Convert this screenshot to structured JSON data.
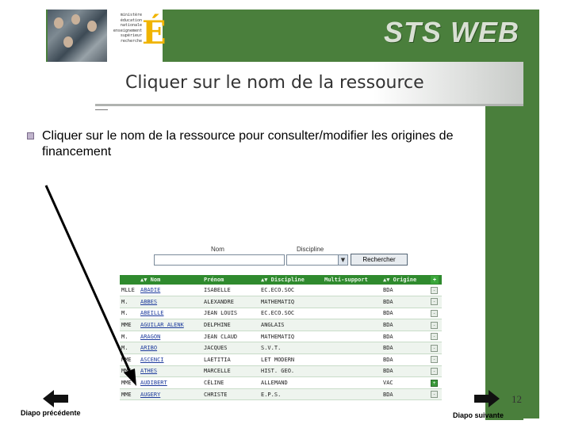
{
  "header": {
    "app_title": "STS WEB",
    "logo_lines": [
      "ministère",
      "éducation",
      "nationale",
      "enseignement",
      "supérieur",
      "recherche"
    ],
    "logo_mark": "É"
  },
  "slide": {
    "title": "Cliquer sur le nom de la ressource",
    "bullet": "Cliquer sur le nom de la ressource pour consulter/modifier les origines de financement",
    "page_number": "12"
  },
  "search_form": {
    "nom_label": "Nom",
    "discipline_label": "Discipline",
    "nom_value": "",
    "discipline_value": "",
    "search_button": "Rechercher"
  },
  "table": {
    "columns": [
      "",
      "Nom",
      "Prénom",
      "Discipline",
      "Multi-support",
      "Origine",
      ""
    ],
    "rows": [
      {
        "civ": "MLLE",
        "nom": "ABADIE",
        "prenom": "ISABELLE",
        "discipline": "EC.ECO.SOC",
        "multi": "",
        "origine": "BDA",
        "active": false
      },
      {
        "civ": "M.",
        "nom": "ABBES",
        "prenom": "ALEXANDRE",
        "discipline": "MATHEMATIQ",
        "multi": "",
        "origine": "BDA",
        "active": false
      },
      {
        "civ": "M.",
        "nom": "ABEILLE",
        "prenom": "JEAN LOUIS",
        "discipline": "EC.ECO.SOC",
        "multi": "",
        "origine": "BDA",
        "active": false
      },
      {
        "civ": "MME",
        "nom": "AGUILAR ALENK",
        "prenom": "DELPHINE",
        "discipline": "ANGLAIS",
        "multi": "",
        "origine": "BDA",
        "active": false
      },
      {
        "civ": "M.",
        "nom": "ARAGON",
        "prenom": "JEAN CLAUD",
        "discipline": "MATHEMATIQ",
        "multi": "",
        "origine": "BDA",
        "active": false
      },
      {
        "civ": "M.",
        "nom": "ARIBO",
        "prenom": "JACQUES",
        "discipline": "S.V.T.",
        "multi": "",
        "origine": "BDA",
        "active": false
      },
      {
        "civ": "MME",
        "nom": "ASCENCI",
        "prenom": "LAETITIA",
        "discipline": "LET MODERN",
        "multi": "",
        "origine": "BDA",
        "active": false
      },
      {
        "civ": "MME",
        "nom": "ATHES",
        "prenom": "MARCELLE",
        "discipline": "HIST. GEO.",
        "multi": "",
        "origine": "BDA",
        "active": false
      },
      {
        "civ": "MME",
        "nom": "AUDIBERT",
        "prenom": "CÉLINE",
        "discipline": "ALLEMAND",
        "multi": "",
        "origine": "VAC",
        "active": true
      },
      {
        "civ": "MME",
        "nom": "AUGERY",
        "prenom": "CHRISTE",
        "discipline": "E.P.S.",
        "multi": "",
        "origine": "BDA",
        "active": false
      }
    ]
  },
  "footer": {
    "prev_label": "Diapo précédente",
    "next_label": "Diapo suivante"
  },
  "colors": {
    "green_band": "#4a7f3c",
    "table_header": "#2f8a2e",
    "link": "#1c3a9c"
  }
}
